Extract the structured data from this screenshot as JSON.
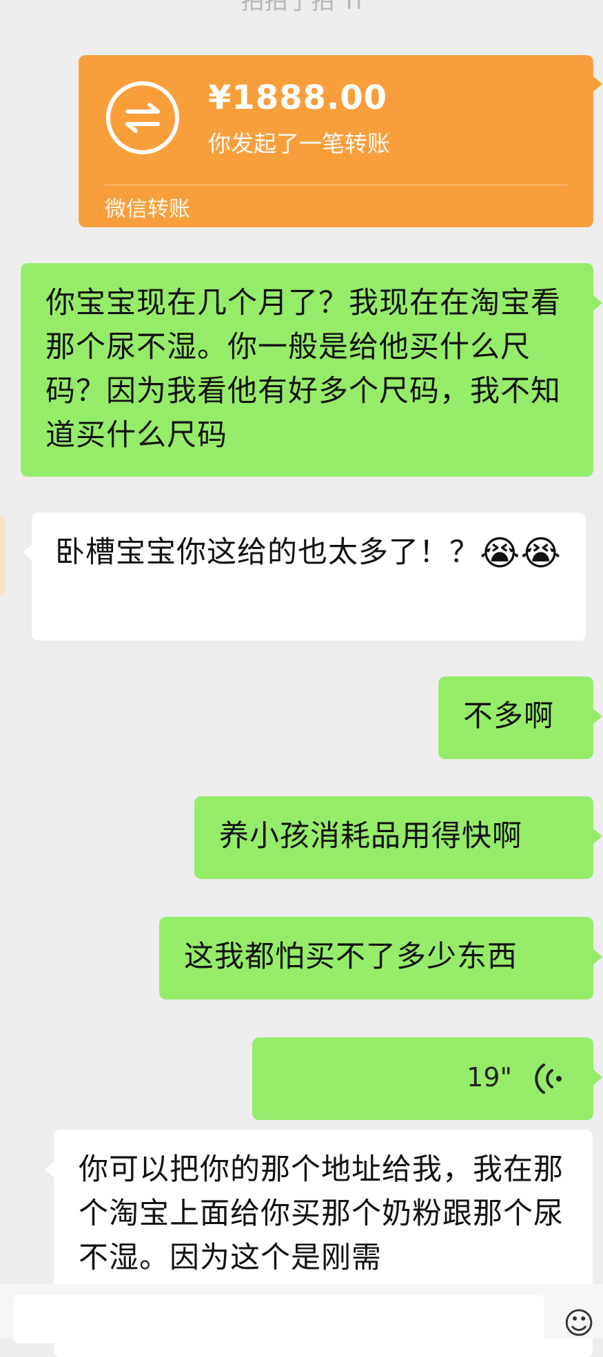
{
  "header": {
    "clipped_title": "拍拍了拍 Ti"
  },
  "transfer": {
    "amount": "¥1888.00",
    "description": "你发起了一笔转账",
    "footer": "微信转账",
    "icon": "transfer-arrows-icon",
    "color": "#f89f3c"
  },
  "messages": [
    {
      "side": "right",
      "text": "你宝宝现在几个月了？我现在在淘宝看那个尿不湿。你一般是给他买什么尺码？因为我看他有好多个尺码，我不知道买什么尺码"
    },
    {
      "side": "left",
      "text": "卧槽宝宝你这给的也太多了！？",
      "emoji": "😭",
      "emoji2": "😭"
    },
    {
      "side": "right",
      "text": "不多啊"
    },
    {
      "side": "right",
      "text": "养小孩消耗品用得快啊"
    },
    {
      "side": "right",
      "text": "这我都怕买不了多少东西"
    },
    {
      "side": "right",
      "type": "voice",
      "duration": "19\"",
      "icon": "voice-wave-icon"
    },
    {
      "side": "left",
      "text": "你可以把你的那个地址给我，我在那个淘宝上面给你买那个奶粉跟那个尿不湿。因为这个是刚需"
    }
  ],
  "colors": {
    "sent": "#95ec69",
    "received": "#ffffff",
    "background": "#ededed"
  }
}
